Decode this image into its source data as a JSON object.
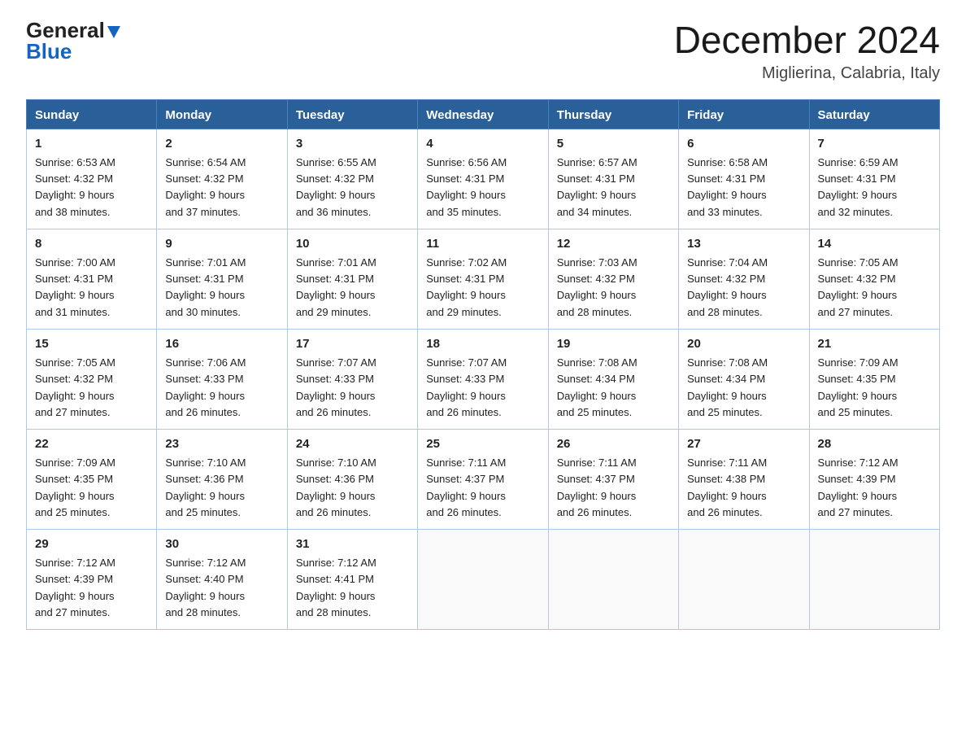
{
  "header": {
    "logo_general": "General",
    "logo_blue": "Blue",
    "title": "December 2024",
    "subtitle": "Miglierina, Calabria, Italy"
  },
  "days_of_week": [
    "Sunday",
    "Monday",
    "Tuesday",
    "Wednesday",
    "Thursday",
    "Friday",
    "Saturday"
  ],
  "weeks": [
    [
      {
        "num": "1",
        "sunrise": "6:53 AM",
        "sunset": "4:32 PM",
        "daylight": "9 hours and 38 minutes."
      },
      {
        "num": "2",
        "sunrise": "6:54 AM",
        "sunset": "4:32 PM",
        "daylight": "9 hours and 37 minutes."
      },
      {
        "num": "3",
        "sunrise": "6:55 AM",
        "sunset": "4:32 PM",
        "daylight": "9 hours and 36 minutes."
      },
      {
        "num": "4",
        "sunrise": "6:56 AM",
        "sunset": "4:31 PM",
        "daylight": "9 hours and 35 minutes."
      },
      {
        "num": "5",
        "sunrise": "6:57 AM",
        "sunset": "4:31 PM",
        "daylight": "9 hours and 34 minutes."
      },
      {
        "num": "6",
        "sunrise": "6:58 AM",
        "sunset": "4:31 PM",
        "daylight": "9 hours and 33 minutes."
      },
      {
        "num": "7",
        "sunrise": "6:59 AM",
        "sunset": "4:31 PM",
        "daylight": "9 hours and 32 minutes."
      }
    ],
    [
      {
        "num": "8",
        "sunrise": "7:00 AM",
        "sunset": "4:31 PM",
        "daylight": "9 hours and 31 minutes."
      },
      {
        "num": "9",
        "sunrise": "7:01 AM",
        "sunset": "4:31 PM",
        "daylight": "9 hours and 30 minutes."
      },
      {
        "num": "10",
        "sunrise": "7:01 AM",
        "sunset": "4:31 PM",
        "daylight": "9 hours and 29 minutes."
      },
      {
        "num": "11",
        "sunrise": "7:02 AM",
        "sunset": "4:31 PM",
        "daylight": "9 hours and 29 minutes."
      },
      {
        "num": "12",
        "sunrise": "7:03 AM",
        "sunset": "4:32 PM",
        "daylight": "9 hours and 28 minutes."
      },
      {
        "num": "13",
        "sunrise": "7:04 AM",
        "sunset": "4:32 PM",
        "daylight": "9 hours and 28 minutes."
      },
      {
        "num": "14",
        "sunrise": "7:05 AM",
        "sunset": "4:32 PM",
        "daylight": "9 hours and 27 minutes."
      }
    ],
    [
      {
        "num": "15",
        "sunrise": "7:05 AM",
        "sunset": "4:32 PM",
        "daylight": "9 hours and 27 minutes."
      },
      {
        "num": "16",
        "sunrise": "7:06 AM",
        "sunset": "4:33 PM",
        "daylight": "9 hours and 26 minutes."
      },
      {
        "num": "17",
        "sunrise": "7:07 AM",
        "sunset": "4:33 PM",
        "daylight": "9 hours and 26 minutes."
      },
      {
        "num": "18",
        "sunrise": "7:07 AM",
        "sunset": "4:33 PM",
        "daylight": "9 hours and 26 minutes."
      },
      {
        "num": "19",
        "sunrise": "7:08 AM",
        "sunset": "4:34 PM",
        "daylight": "9 hours and 25 minutes."
      },
      {
        "num": "20",
        "sunrise": "7:08 AM",
        "sunset": "4:34 PM",
        "daylight": "9 hours and 25 minutes."
      },
      {
        "num": "21",
        "sunrise": "7:09 AM",
        "sunset": "4:35 PM",
        "daylight": "9 hours and 25 minutes."
      }
    ],
    [
      {
        "num": "22",
        "sunrise": "7:09 AM",
        "sunset": "4:35 PM",
        "daylight": "9 hours and 25 minutes."
      },
      {
        "num": "23",
        "sunrise": "7:10 AM",
        "sunset": "4:36 PM",
        "daylight": "9 hours and 25 minutes."
      },
      {
        "num": "24",
        "sunrise": "7:10 AM",
        "sunset": "4:36 PM",
        "daylight": "9 hours and 26 minutes."
      },
      {
        "num": "25",
        "sunrise": "7:11 AM",
        "sunset": "4:37 PM",
        "daylight": "9 hours and 26 minutes."
      },
      {
        "num": "26",
        "sunrise": "7:11 AM",
        "sunset": "4:37 PM",
        "daylight": "9 hours and 26 minutes."
      },
      {
        "num": "27",
        "sunrise": "7:11 AM",
        "sunset": "4:38 PM",
        "daylight": "9 hours and 26 minutes."
      },
      {
        "num": "28",
        "sunrise": "7:12 AM",
        "sunset": "4:39 PM",
        "daylight": "9 hours and 27 minutes."
      }
    ],
    [
      {
        "num": "29",
        "sunrise": "7:12 AM",
        "sunset": "4:39 PM",
        "daylight": "9 hours and 27 minutes."
      },
      {
        "num": "30",
        "sunrise": "7:12 AM",
        "sunset": "4:40 PM",
        "daylight": "9 hours and 28 minutes."
      },
      {
        "num": "31",
        "sunrise": "7:12 AM",
        "sunset": "4:41 PM",
        "daylight": "9 hours and 28 minutes."
      },
      null,
      null,
      null,
      null
    ]
  ],
  "labels": {
    "sunrise": "Sunrise:",
    "sunset": "Sunset:",
    "daylight": "Daylight:"
  }
}
